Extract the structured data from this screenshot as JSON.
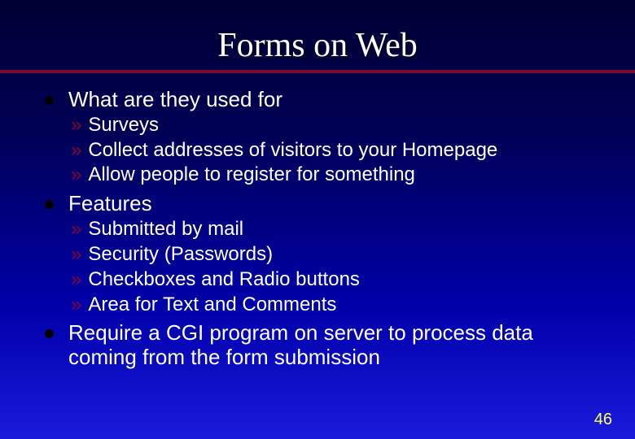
{
  "title": "Forms on Web",
  "bullets": [
    {
      "label": "What are they used for",
      "subs": [
        "Surveys",
        "Collect addresses of visitors to your Homepage",
        "Allow people to register for something"
      ]
    },
    {
      "label": "Features",
      "subs": [
        "Submitted by mail",
        "Security  (Passwords)",
        "Checkboxes and Radio buttons",
        "Area for Text and Comments"
      ]
    },
    {
      "label": "Require a CGI program on server to process data coming from the form submission",
      "subs": []
    }
  ],
  "page_number": "46",
  "sub_marker": "»"
}
